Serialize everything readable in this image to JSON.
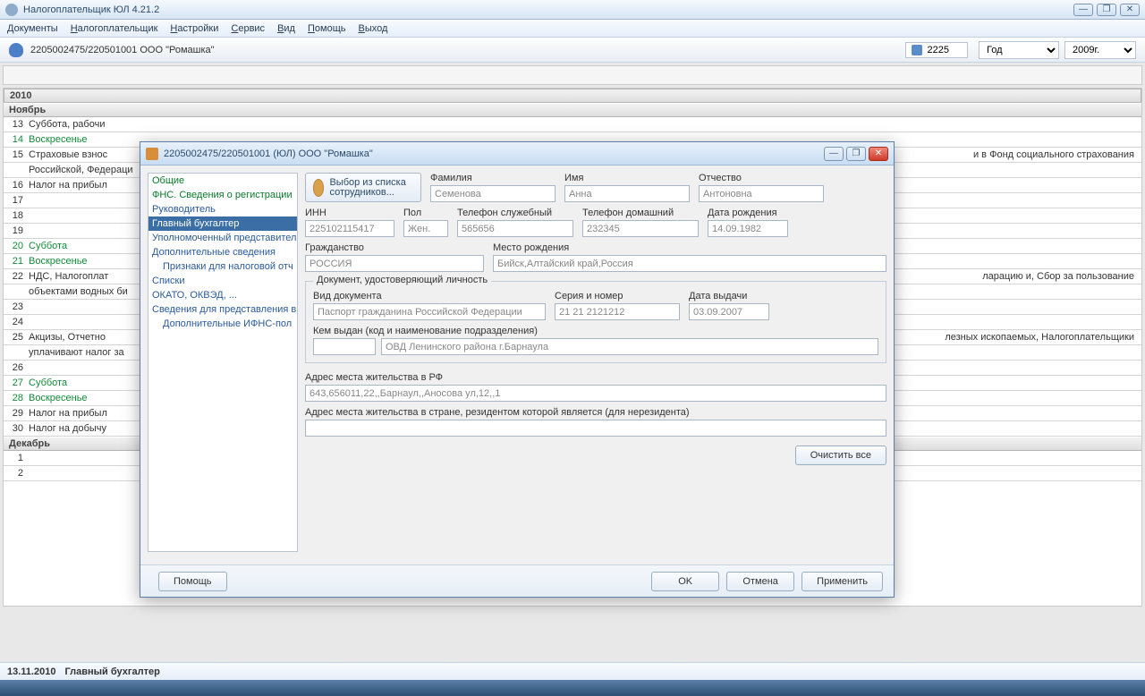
{
  "window": {
    "title": "Налогоплательщик ЮЛ 4.21.2"
  },
  "menu": {
    "items": [
      "Документы",
      "Налогоплательщик",
      "Настройки",
      "Сервис",
      "Вид",
      "Помощь",
      "Выход"
    ]
  },
  "toolbar": {
    "org": "2205002475/220501001 ООО \"Ромашка\"",
    "code": "2225",
    "period_label": "Год",
    "year": "2009г."
  },
  "calendar": {
    "year": "2010",
    "month1": "Ноябрь",
    "month2": "Декабрь",
    "rows": [
      {
        "n": "13",
        "t": "Суббота, рабочи",
        "cls": ""
      },
      {
        "n": "14",
        "t": "Воскресенье",
        "cls": "sun"
      },
      {
        "n": "15",
        "t": "Страховые взнос",
        "t2": "Российской, Федераци",
        "cls": "",
        "tail": "и в Фонд социального страхования"
      },
      {
        "n": "16",
        "t": "Налог на прибыл",
        "cls": ""
      },
      {
        "n": "17",
        "t": "",
        "cls": ""
      },
      {
        "n": "18",
        "t": "",
        "cls": ""
      },
      {
        "n": "19",
        "t": "",
        "cls": ""
      },
      {
        "n": "20",
        "t": "Суббота",
        "cls": "sat"
      },
      {
        "n": "21",
        "t": "Воскресенье",
        "cls": "sun"
      },
      {
        "n": "22",
        "t": "НДС, Налогоплат",
        "t2": "объектами водных би",
        "cls": "",
        "tail": "ларацию и, Сбор за пользование"
      },
      {
        "n": "23",
        "t": "",
        "cls": ""
      },
      {
        "n": "24",
        "t": "",
        "cls": ""
      },
      {
        "n": "25",
        "t": "Акцизы, Отчетно",
        "t2": "уплачивают налог за",
        "cls": "",
        "tail": "лезных ископаемых, Налогоплательщики"
      },
      {
        "n": "26",
        "t": "",
        "cls": ""
      },
      {
        "n": "27",
        "t": "Суббота",
        "cls": "sat"
      },
      {
        "n": "28",
        "t": "Воскресенье",
        "cls": "sun"
      },
      {
        "n": "29",
        "t": "Налог на прибыл",
        "cls": ""
      },
      {
        "n": "30",
        "t": "Налог на добычу",
        "cls": ""
      }
    ],
    "dec_rows": [
      {
        "n": "1",
        "t": ""
      },
      {
        "n": "2",
        "t": ""
      }
    ]
  },
  "status": {
    "date": "13.11.2010",
    "role": "Главный бухгалтер"
  },
  "dialog": {
    "title": "2205002475/220501001 (ЮЛ) ООО \"Ромашка\"",
    "nav": [
      {
        "label": "Общие",
        "cls": "green"
      },
      {
        "label": "ФНС. Сведения о регистрации",
        "cls": "green"
      },
      {
        "label": "Руководитель",
        "cls": ""
      },
      {
        "label": "Главный бухгалтер",
        "cls": "sel"
      },
      {
        "label": "Уполномоченный представител",
        "cls": ""
      },
      {
        "label": "Дополнительные сведения",
        "cls": ""
      },
      {
        "label": "Признаки для налоговой отч",
        "cls": "ind"
      },
      {
        "label": "Списки",
        "cls": ""
      },
      {
        "label": "ОКАТО, ОКВЭД, ...",
        "cls": ""
      },
      {
        "label": "Сведения для представления в",
        "cls": ""
      },
      {
        "label": "Дополнительные ИФНС-пол",
        "cls": "ind"
      }
    ],
    "pick": "Выбор из списка сотрудников...",
    "labels": {
      "surname": "Фамилия",
      "name": "Имя",
      "patronymic": "Отчество",
      "inn": "ИНН",
      "gender": "Пол",
      "work_phone": "Телефон служебный",
      "home_phone": "Телефон домашний",
      "dob": "Дата рождения",
      "citizenship": "Гражданство",
      "birthplace": "Место рождения",
      "doc_frame": "Документ, удостоверяющий личность",
      "doc_type": "Вид документа",
      "doc_series": "Серия и номер",
      "doc_date": "Дата выдачи",
      "issued_by": "Кем выдан (код и наименование подразделения)",
      "address_rf": "Адрес места жительства в РФ",
      "address_nr": "Адрес места жительства в стране, резидентом которой является (для нерезидента)"
    },
    "values": {
      "surname": "Семенова",
      "name": "Анна",
      "patronymic": "Антоновна",
      "inn": "225102115417",
      "gender": "Жен.",
      "work_phone": "565656",
      "home_phone": "232345",
      "dob": "14.09.1982",
      "citizenship": "РОССИЯ",
      "birthplace": "Бийск,Алтайский край,Россия",
      "doc_type": "Паспорт гражданина Российской Федерации",
      "doc_series": "21 21 2121212",
      "doc_date": "03.09.2007",
      "issued_code": "",
      "issued_by": "ОВД Ленинского района г.Барнаула",
      "address_rf": "643,656011,22,,Барнаул,,Аносова ул,12,,1",
      "address_nr": ""
    },
    "buttons": {
      "clear": "Очистить все",
      "help": "Помощь",
      "ok": "OK",
      "cancel": "Отмена",
      "apply": "Применить"
    }
  }
}
